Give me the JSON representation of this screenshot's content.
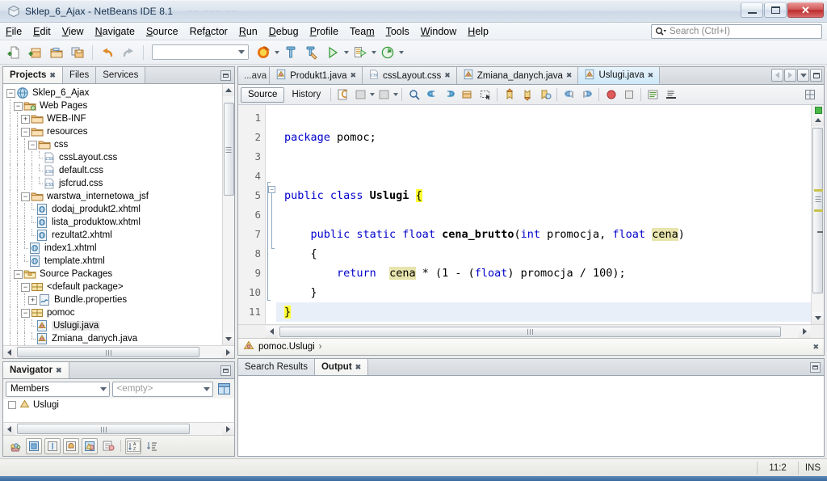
{
  "window": {
    "title": "Sklep_6_Ajax - NetBeans IDE 8.1",
    "app_icon": "netbeans-cube-icon",
    "minimize_label": "Minimize",
    "maximize_label": "Maximize",
    "close_label": "Close"
  },
  "menubar": {
    "items": [
      {
        "label": "File",
        "mnemonic": "F"
      },
      {
        "label": "Edit",
        "mnemonic": "E"
      },
      {
        "label": "View",
        "mnemonic": "V"
      },
      {
        "label": "Navigate",
        "mnemonic": "N"
      },
      {
        "label": "Source",
        "mnemonic": "S"
      },
      {
        "label": "Refactor",
        "mnemonic": "a"
      },
      {
        "label": "Run",
        "mnemonic": "R"
      },
      {
        "label": "Debug",
        "mnemonic": "D"
      },
      {
        "label": "Profile",
        "mnemonic": "P"
      },
      {
        "label": "Team",
        "mnemonic": "m"
      },
      {
        "label": "Tools",
        "mnemonic": "T"
      },
      {
        "label": "Window",
        "mnemonic": "W"
      },
      {
        "label": "Help",
        "mnemonic": "H"
      }
    ],
    "search": {
      "placeholder": "Search (Ctrl+I)",
      "value": "",
      "icon": "search-icon"
    }
  },
  "toolbar": {
    "buttons": [
      {
        "name": "new-file-button",
        "icon": "new-file-icon"
      },
      {
        "name": "new-project-button",
        "icon": "new-project-icon"
      },
      {
        "name": "open-project-button",
        "icon": "open-project-icon"
      },
      {
        "name": "save-all-button",
        "icon": "save-all-icon"
      },
      {
        "name": "undo-button",
        "icon": "undo-icon"
      },
      {
        "name": "redo-button",
        "icon": "redo-icon"
      }
    ],
    "config_combo": {
      "value": "",
      "name": "project-configuration-combo"
    },
    "run_buttons": [
      {
        "name": "browser-select-button",
        "icon": "firefox-icon"
      },
      {
        "name": "build-project-button",
        "icon": "hammer-icon"
      },
      {
        "name": "clean-build-button",
        "icon": "clean-build-icon"
      },
      {
        "name": "run-project-button",
        "icon": "run-icon"
      },
      {
        "name": "debug-project-button",
        "icon": "debug-icon"
      },
      {
        "name": "profile-project-button",
        "icon": "profile-icon"
      }
    ]
  },
  "projects_panel": {
    "tabs": [
      {
        "label": "Projects",
        "active": true,
        "closable": true
      },
      {
        "label": "Files",
        "active": false,
        "closable": false
      },
      {
        "label": "Services",
        "active": false,
        "closable": false
      }
    ],
    "minimize_label": "Minimize Window",
    "tree": [
      {
        "label": "Sklep_6_Ajax",
        "depth": 0,
        "icon": "project-web-icon",
        "toggle": "minus",
        "selected": false
      },
      {
        "label": "Web Pages",
        "depth": 1,
        "icon": "web-pages-folder-icon",
        "toggle": "minus",
        "selected": false
      },
      {
        "label": "WEB-INF",
        "depth": 2,
        "icon": "folder-icon",
        "toggle": "plus",
        "selected": false
      },
      {
        "label": "resources",
        "depth": 2,
        "icon": "folder-icon",
        "toggle": "minus",
        "selected": false
      },
      {
        "label": "css",
        "depth": 3,
        "icon": "folder-icon",
        "toggle": "minus",
        "selected": false
      },
      {
        "label": "cssLayout.css",
        "depth": 4,
        "icon": "css-file-icon",
        "toggle": "none",
        "selected": false
      },
      {
        "label": "default.css",
        "depth": 4,
        "icon": "css-file-icon",
        "toggle": "none",
        "selected": false
      },
      {
        "label": "jsfcrud.css",
        "depth": 4,
        "icon": "css-file-icon",
        "toggle": "none",
        "selected": false
      },
      {
        "label": "warstwa_internetowa_jsf",
        "depth": 2,
        "icon": "folder-icon",
        "toggle": "minus",
        "selected": false
      },
      {
        "label": "dodaj_produkt2.xhtml",
        "depth": 3,
        "icon": "xhtml-file-icon",
        "toggle": "none",
        "selected": false
      },
      {
        "label": "lista_produktow.xhtml",
        "depth": 3,
        "icon": "xhtml-file-icon",
        "toggle": "none",
        "selected": false
      },
      {
        "label": "rezultat2.xhtml",
        "depth": 3,
        "icon": "xhtml-file-icon",
        "toggle": "none",
        "selected": false
      },
      {
        "label": "index1.xhtml",
        "depth": 2,
        "icon": "xhtml-file-icon",
        "toggle": "none",
        "selected": false
      },
      {
        "label": "template.xhtml",
        "depth": 2,
        "icon": "xhtml-file-icon",
        "toggle": "none",
        "selected": false
      },
      {
        "label": "Source Packages",
        "depth": 1,
        "icon": "source-packages-icon",
        "toggle": "minus",
        "selected": false
      },
      {
        "label": "<default package>",
        "depth": 2,
        "icon": "package-icon",
        "toggle": "minus",
        "selected": false
      },
      {
        "label": "Bundle.properties",
        "depth": 3,
        "icon": "properties-file-icon",
        "toggle": "plus",
        "selected": false
      },
      {
        "label": "pomoc",
        "depth": 2,
        "icon": "package-icon",
        "toggle": "minus",
        "selected": false
      },
      {
        "label": "Uslugi.java",
        "depth": 3,
        "icon": "java-file-icon",
        "toggle": "none",
        "selected": true
      },
      {
        "label": "Zmiana_danych.java",
        "depth": 3,
        "icon": "java-file-icon",
        "toggle": "none",
        "selected": false
      }
    ]
  },
  "navigator_panel": {
    "tab_label": "Navigator",
    "minimize_label": "Minimize Window",
    "scope_combo": {
      "value": "Members",
      "name": "navigator-scope-combo"
    },
    "filter_combo": {
      "value": "<empty>",
      "name": "navigator-filter-combo"
    },
    "inspect_button": "inspect-members-icon",
    "first_item": "Uslugi",
    "toolbar_buttons": [
      {
        "name": "filter-button",
        "icon": "filter-icon"
      },
      {
        "name": "show-non-public-button",
        "icon": "non-public-members-icon"
      },
      {
        "name": "show-static-button",
        "icon": "static-members-icon"
      },
      {
        "name": "show-fields-button",
        "icon": "fields-icon"
      },
      {
        "name": "show-inherited-button",
        "icon": "inherited-members-icon"
      },
      {
        "name": "expand-all-button",
        "icon": "expand-all-icon"
      },
      {
        "name": "sort-alphabetically-button",
        "icon": "sort-alpha-icon"
      },
      {
        "name": "sort-by-source-button",
        "icon": "sort-source-icon"
      }
    ]
  },
  "editor": {
    "tabs": [
      {
        "label": "...ava",
        "icon": "java-file-icon",
        "active": false,
        "clipped": true,
        "closable": false
      },
      {
        "label": "Produkt1.java",
        "icon": "java-file-icon",
        "active": false,
        "clipped": false,
        "closable": true
      },
      {
        "label": "cssLayout.css",
        "icon": "css-file-icon",
        "active": false,
        "clipped": false,
        "closable": true
      },
      {
        "label": "Zmiana_danych.java",
        "icon": "java-file-icon",
        "active": false,
        "clipped": false,
        "closable": true
      },
      {
        "label": "Uslugi.java",
        "icon": "java-file-icon",
        "active": true,
        "clipped": false,
        "closable": true
      }
    ],
    "tab_controls": [
      {
        "name": "scroll-tabs-left-button",
        "icon": "chevron-left-icon"
      },
      {
        "name": "scroll-tabs-right-button",
        "icon": "chevron-right-icon"
      },
      {
        "name": "tab-list-button",
        "icon": "chevron-down-icon"
      },
      {
        "name": "maximize-editor-button",
        "icon": "maximize-icon"
      }
    ],
    "view_tabs": [
      {
        "label": "Source",
        "active": true
      },
      {
        "label": "History",
        "active": false
      }
    ],
    "toolbar_buttons": [
      {
        "name": "last-edit-button",
        "icon": "last-edit-icon"
      },
      {
        "name": "shift-left-button",
        "icon": "shift-left-icon"
      },
      {
        "name": "shift-right-button",
        "icon": "shift-right-icon"
      },
      {
        "name": "find-selection-button",
        "icon": "find-selection-icon"
      },
      {
        "name": "find-previous-button",
        "icon": "find-previous-icon"
      },
      {
        "name": "find-next-button",
        "icon": "find-next-icon"
      },
      {
        "name": "toggle-rect-select-button",
        "icon": "rectangular-selection-icon"
      },
      {
        "name": "previous-bookmark-button",
        "icon": "previous-bookmark-icon"
      },
      {
        "name": "next-bookmark-button",
        "icon": "next-bookmark-icon"
      },
      {
        "name": "toggle-bookmark-button",
        "icon": "toggle-bookmark-icon"
      },
      {
        "name": "shift-line-left-button",
        "icon": "shift-line-left-icon"
      },
      {
        "name": "shift-line-right-button",
        "icon": "shift-line-right-icon"
      },
      {
        "name": "toggle-breakpoint-button",
        "icon": "breakpoint-icon"
      },
      {
        "name": "stop-button",
        "icon": "stop-icon"
      },
      {
        "name": "comment-button",
        "icon": "comment-icon"
      },
      {
        "name": "uncomment-button",
        "icon": "uncomment-icon"
      }
    ],
    "options_button": "editor-options-icon",
    "error_stripe_status": "no-errors",
    "error_stripe_color": "#4ab94a",
    "lines": [
      {
        "n": 1,
        "current": false,
        "tokens": []
      },
      {
        "n": 2,
        "current": false,
        "tokens": [
          {
            "t": "package",
            "c": "kw"
          },
          {
            "t": " pomoc;",
            "c": ""
          }
        ]
      },
      {
        "n": 3,
        "current": false,
        "tokens": []
      },
      {
        "n": 4,
        "current": false,
        "tokens": []
      },
      {
        "n": 5,
        "current": false,
        "tokens": [
          {
            "t": "public class ",
            "c": "kw"
          },
          {
            "t": "Uslugi",
            "c": "bold"
          },
          {
            "t": " ",
            "c": ""
          },
          {
            "t": "{",
            "c": "hl-brace"
          }
        ]
      },
      {
        "n": 6,
        "current": false,
        "tokens": []
      },
      {
        "n": 7,
        "current": false,
        "tokens": [
          {
            "t": "    ",
            "c": ""
          },
          {
            "t": "public static float ",
            "c": "kw"
          },
          {
            "t": "cena_brutto",
            "c": "bold"
          },
          {
            "t": "(",
            "c": ""
          },
          {
            "t": "int",
            "c": "kw"
          },
          {
            "t": " promocja, ",
            "c": ""
          },
          {
            "t": "float",
            "c": "kw"
          },
          {
            "t": " ",
            "c": ""
          },
          {
            "t": "cena",
            "c": "hl-occ"
          },
          {
            "t": ")",
            "c": ""
          }
        ]
      },
      {
        "n": 8,
        "current": false,
        "tokens": [
          {
            "t": "    {",
            "c": ""
          }
        ]
      },
      {
        "n": 9,
        "current": false,
        "tokens": [
          {
            "t": "        ",
            "c": ""
          },
          {
            "t": "return",
            "c": "kw"
          },
          {
            "t": "  ",
            "c": ""
          },
          {
            "t": "cena",
            "c": "hl-occ"
          },
          {
            "t": " * (1 - (",
            "c": ""
          },
          {
            "t": "float",
            "c": "kw"
          },
          {
            "t": ") promocja / 100);",
            "c": ""
          }
        ]
      },
      {
        "n": 10,
        "current": false,
        "tokens": [
          {
            "t": "    }",
            "c": ""
          }
        ]
      },
      {
        "n": 11,
        "current": true,
        "tokens": [
          {
            "t": "}",
            "c": "hl-brace"
          }
        ]
      }
    ],
    "breadcrumb": {
      "icon": "java-class-icon",
      "text": "pomoc.Uslugi",
      "separator": "›",
      "close_label": "Close"
    }
  },
  "output_panel": {
    "tabs": [
      {
        "label": "Search Results",
        "active": false,
        "closable": false
      },
      {
        "label": "Output",
        "active": true,
        "closable": true
      }
    ],
    "minimize_label": "Minimize Window",
    "content": ""
  },
  "statusbar": {
    "cursor_position": "11:2",
    "insert_mode": "INS"
  },
  "colors": {
    "keyword": "#0000cc",
    "brace_highlight": "#ffff33",
    "occurrence_highlight": "#e8e4ad",
    "current_line": "#e9eff9",
    "selection": "#e8e8e8",
    "active_tab": "#cfe8f7",
    "error_free": "#4ab94a"
  }
}
